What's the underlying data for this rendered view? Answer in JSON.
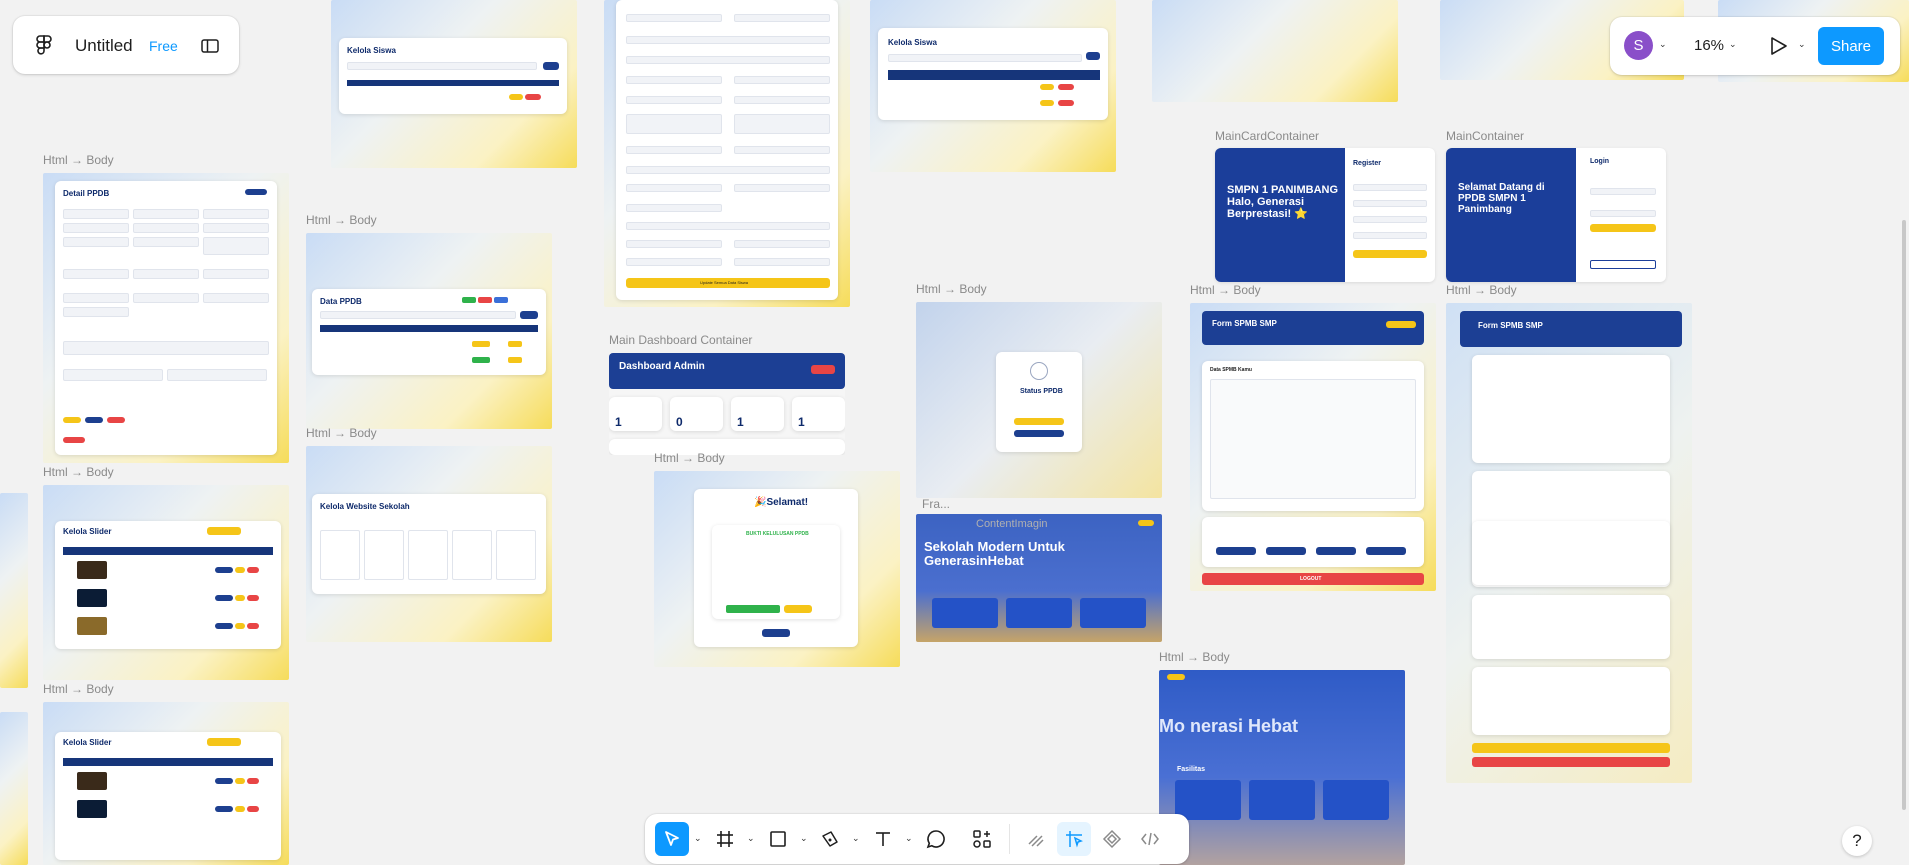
{
  "file": {
    "name": "Untitled",
    "plan": "Free"
  },
  "header_right": {
    "avatar_initial": "S",
    "zoom": "16%",
    "share_label": "Share"
  },
  "help_label": "?",
  "frames": {
    "f1": {
      "label": "Html → Body",
      "title": "Detail PPDB"
    },
    "f2": {
      "label": "Html → Body",
      "title": "Kelola Slider"
    },
    "f3": {
      "label": "Html → Body",
      "title": "Kelola Slider"
    },
    "f4": {
      "title": "Kelola Siswa"
    },
    "f5": {
      "label": "Html → Body",
      "title": "Data PPDB"
    },
    "f6": {
      "label": "Html → Body",
      "title": "Kelola Website Sekolah"
    },
    "f7": {
      "button": "Update Semua Data Siswa"
    },
    "f8": {
      "label": "Main Dashboard Container",
      "title": "Dashboard Admin",
      "stats": [
        "1",
        "0",
        "1",
        "1"
      ]
    },
    "f9": {
      "label": "Html → Body",
      "title": "🎉Selamat!",
      "sub": "BUKTI KELULUSAN PPDB"
    },
    "f10": {
      "title": "Kelola Siswa"
    },
    "f11": {
      "label": "Html → Body",
      "title": "Status PPDB"
    },
    "f12": {
      "label": "Fra...",
      "title": "Sekolah Modern Untuk GenerasinHebat",
      "overlay": "ContentImagin"
    },
    "f13": {
      "label": "MainCardContainer",
      "title": "SMPN 1 PANIMBANG Halo, Generasi Berprestasi! ⭐",
      "form_title": "Register"
    },
    "f14": {
      "label": "MainContainer",
      "title": "Selamat Datang di PPDB SMPN 1 Panimbang",
      "form_title": "Login"
    },
    "f15": {
      "label": "Html → Body",
      "title": "Form SPMB SMP",
      "section": "Data SPMB Kamu",
      "logout": "LOGOUT"
    },
    "f16": {
      "label": "Html → Body",
      "title": "Form SPMB SMP"
    },
    "f17": {
      "label": "Html → Body",
      "title": "Mo     nerasi Hebat",
      "sub": "Fasilitas"
    }
  },
  "colors": {
    "accent": "#0d99ff",
    "navy": "#16357a",
    "yellow": "#f5c518",
    "red": "#e84545"
  }
}
